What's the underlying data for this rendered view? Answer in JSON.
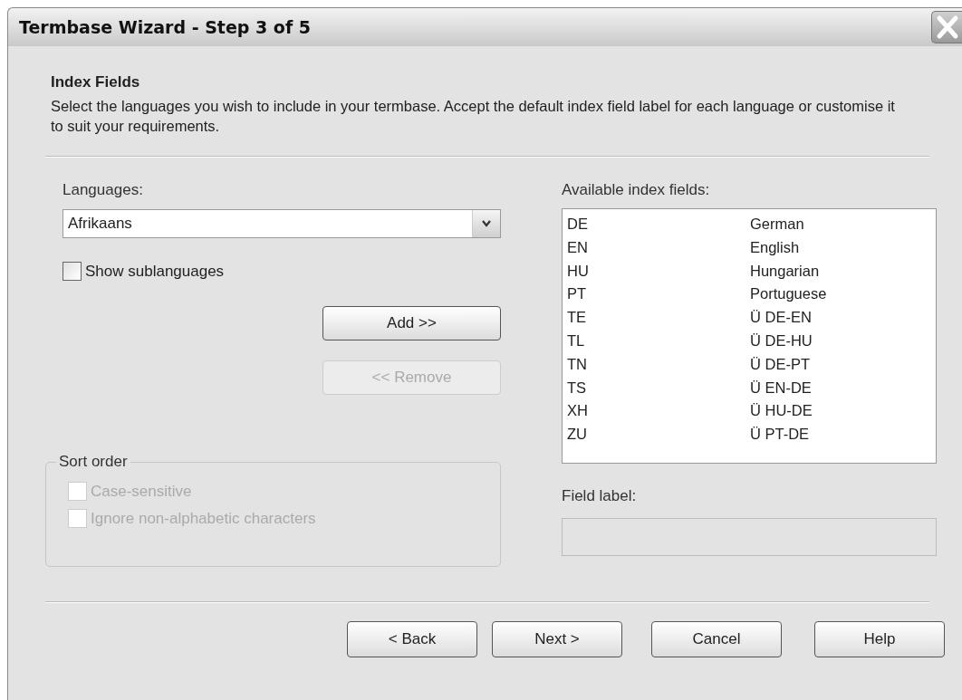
{
  "window": {
    "title": "Termbase Wizard - Step 3 of 5"
  },
  "header": {
    "title": "Index Fields",
    "description": "Select the languages you wish to include in your termbase. Accept the default index field label for each language or customise it to suit your requirements."
  },
  "languages": {
    "label": "Languages:",
    "value": "Afrikaans"
  },
  "show_sublanguages": {
    "label": "Show sublanguages",
    "checked": false,
    "disabled": false
  },
  "add_button": {
    "label": "Add >>",
    "disabled": false
  },
  "remove_button": {
    "label": "<< Remove",
    "disabled": true
  },
  "sort_order": {
    "title": "Sort order",
    "options": [
      {
        "label": "Case-sensitive",
        "checked": false,
        "disabled": true
      },
      {
        "label": "Ignore non-alphabetic characters",
        "checked": false,
        "disabled": true
      }
    ]
  },
  "index_fields": {
    "label": "Available index fields:",
    "items": [
      {
        "code": "DE",
        "name": "German",
        "selected": false
      },
      {
        "code": "EN",
        "name": "English",
        "selected": false
      },
      {
        "code": "HU",
        "name": "Hungarian",
        "selected": false
      },
      {
        "code": "PT",
        "name": "Portuguese",
        "selected": false
      },
      {
        "code": "TE",
        "name": "Ü DE-EN",
        "selected": false
      },
      {
        "code": "TL",
        "name": "Ü DE-HU",
        "selected": false
      },
      {
        "code": "TN",
        "name": "Ü DE-PT",
        "selected": false
      },
      {
        "code": "TS",
        "name": "Ü EN-DE",
        "selected": false
      },
      {
        "code": "XH",
        "name": "Ü HU-DE",
        "selected": false
      },
      {
        "code": "ZU",
        "name": "Ü PT-DE",
        "selected": false
      }
    ]
  },
  "field_label": {
    "label": "Field label:",
    "disabled": true
  },
  "buttons": [
    {
      "label": "< Back",
      "disabled": false
    },
    {
      "label": "Next >",
      "disabled": false
    },
    {
      "label": "Cancel",
      "disabled": false
    },
    {
      "label": "Help",
      "disabled": false
    }
  ]
}
